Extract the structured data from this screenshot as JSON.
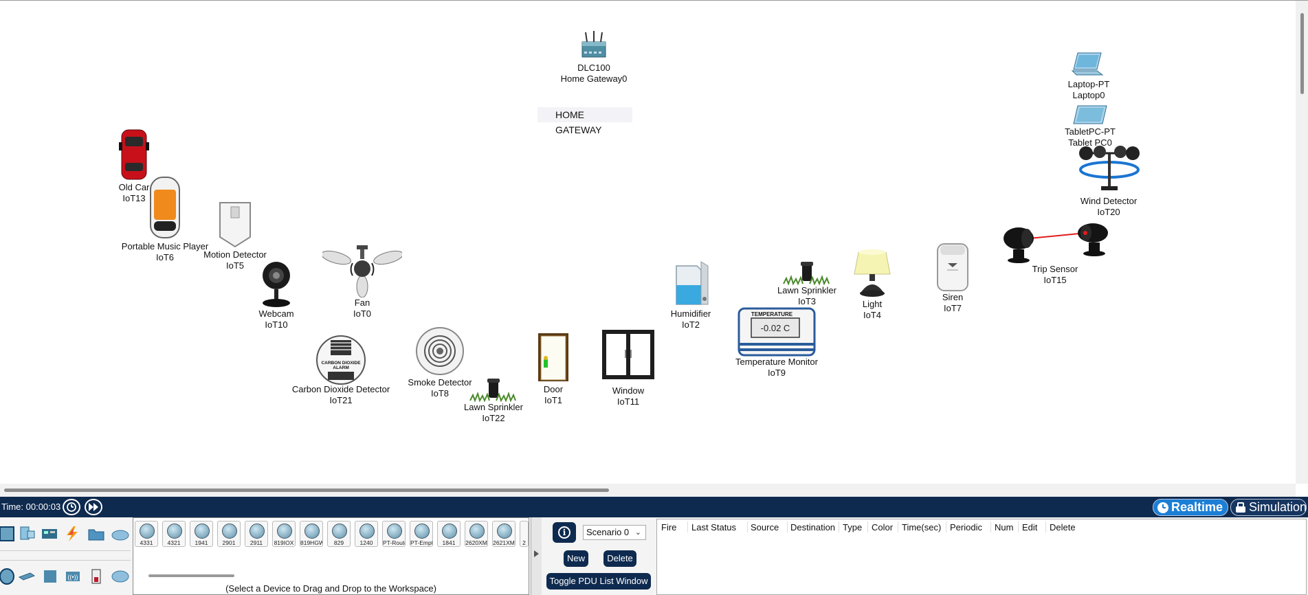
{
  "devices": {
    "gateway": {
      "line1": "DLC100",
      "line2": "Home Gateway0"
    },
    "home_gateway_note": "HOME GATEWAY",
    "laptop": {
      "line1": "Laptop-PT",
      "line2": "Laptop0"
    },
    "tablet": {
      "line1": "TabletPC-PT",
      "line2": "Tablet PC0"
    },
    "wind": {
      "line1": "Wind Detector",
      "line2": "IoT20"
    },
    "old_car": {
      "line1": "Old Car",
      "line2": "IoT13"
    },
    "music": {
      "line1": "Portable Music Player",
      "line2": "IoT6"
    },
    "motion": {
      "line1": "Motion Detector",
      "line2": "IoT5"
    },
    "webcam": {
      "line1": "Webcam",
      "line2": "IoT10"
    },
    "fan": {
      "line1": "Fan",
      "line2": "IoT0"
    },
    "co2": {
      "line1": "Carbon Dioxide Detector",
      "line2": "IoT21",
      "face_text": "CARBON DIOXIDE ALARM"
    },
    "smoke": {
      "line1": "Smoke Detector",
      "line2": "IoT8"
    },
    "sprinkler22": {
      "line1": "Lawn Sprinkler",
      "line2": "IoT22"
    },
    "door": {
      "line1": "Door",
      "line2": "IoT1"
    },
    "window": {
      "line1": "Window",
      "line2": "IoT11"
    },
    "humidifier": {
      "line1": "Humidifier",
      "line2": "IoT2"
    },
    "temp": {
      "line1": "Temperature Monitor",
      "line2": "IoT9",
      "header": "TEMPERATURE",
      "reading": "-0.02 C"
    },
    "sprinkler3": {
      "line1": "Lawn Sprinkler",
      "line2": "IoT3"
    },
    "light": {
      "line1": "Light",
      "line2": "IoT4"
    },
    "siren": {
      "line1": "Siren",
      "line2": "IoT7"
    },
    "trip": {
      "line1": "Trip Sensor",
      "line2": "IoT15"
    }
  },
  "bottom_bar": {
    "time": "Time: 00:00:03",
    "realtime": "Realtime",
    "simulation": "Simulation"
  },
  "device_models": [
    "4331",
    "4321",
    "1941",
    "2901",
    "2911",
    "819IOX",
    "819HGW",
    "829",
    "1240",
    "PT-Router",
    "PT-Empty",
    "1841",
    "2620XM",
    "2621XM",
    "2"
  ],
  "device_hint": "(Select a Device to Drag and Drop to the Workspace)",
  "scenario": {
    "info": "i",
    "selected": "Scenario 0",
    "new": "New",
    "delete": "Delete",
    "toggle": "Toggle PDU List Window"
  },
  "pdu_columns": [
    "Fire",
    "Last Status",
    "Source",
    "Destination",
    "Type",
    "Color",
    "Time(sec)",
    "Periodic",
    "Num",
    "Edit",
    "Delete"
  ],
  "colors": {
    "bar": "#0e2a4f",
    "realtime": "#1c7fd6",
    "simulation": "#163560"
  }
}
